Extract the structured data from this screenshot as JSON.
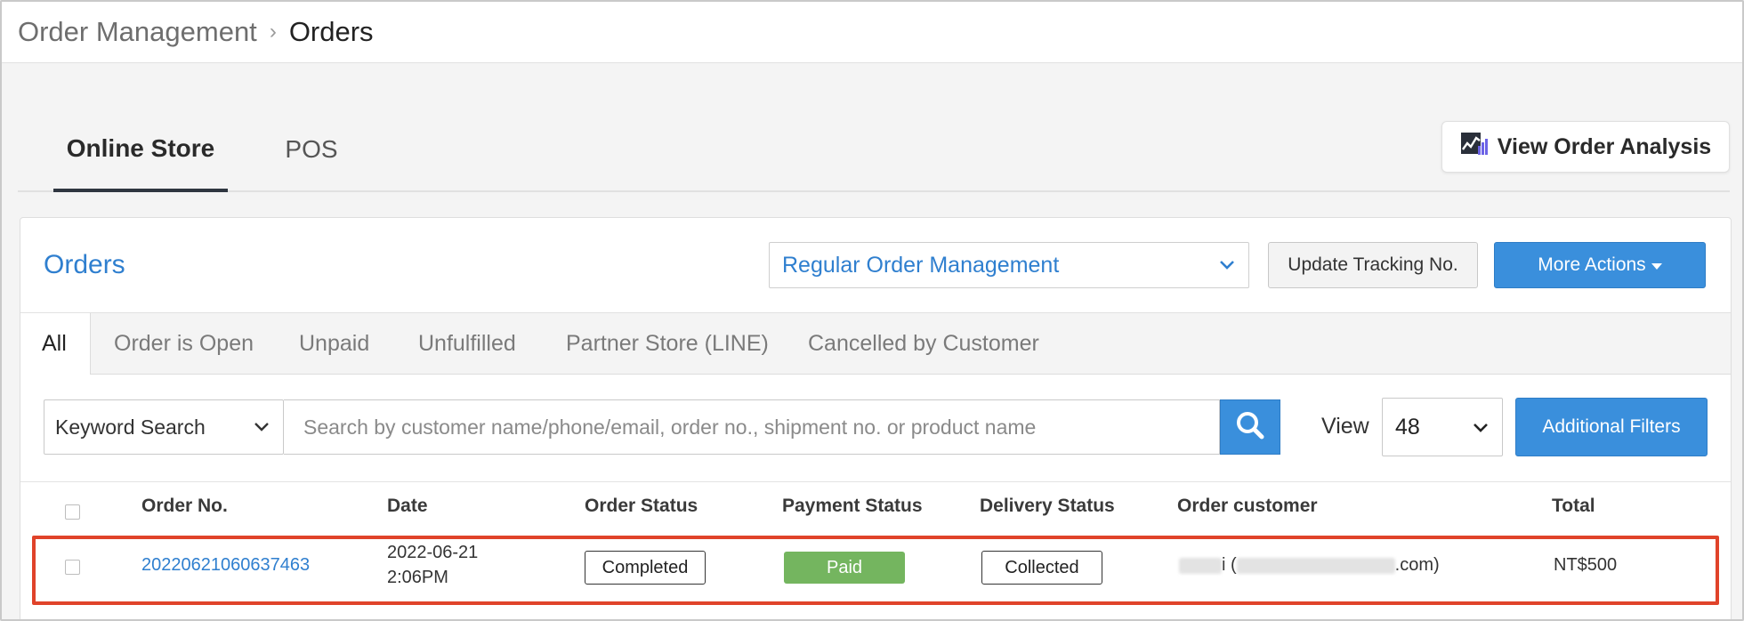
{
  "breadcrumb": {
    "parent": "Order Management",
    "separator": "›",
    "current": "Orders"
  },
  "store_tabs": [
    {
      "label": "Online Store",
      "active": true
    },
    {
      "label": "POS",
      "active": false
    }
  ],
  "analysis_button": {
    "label": "View Order Analysis",
    "icon": "chart-icon"
  },
  "panel": {
    "title": "Orders",
    "management_select": {
      "value": "Regular Order Management"
    },
    "update_tracking_label": "Update Tracking No.",
    "more_actions_label": "More Actions"
  },
  "filter_tabs": [
    {
      "label": "All",
      "active": true
    },
    {
      "label": "Order is Open"
    },
    {
      "label": "Unpaid"
    },
    {
      "label": "Unfulfilled"
    },
    {
      "label": "Partner Store (LINE)"
    },
    {
      "label": "Cancelled by Customer"
    }
  ],
  "search": {
    "type_select": "Keyword Search",
    "placeholder": "Search by customer name/phone/email, order no., shipment no. or product name",
    "value": "",
    "view_label": "View",
    "view_value": "48",
    "additional_filters_label": "Additional Filters"
  },
  "table": {
    "columns": [
      "Order No.",
      "Date",
      "Order Status",
      "Payment Status",
      "Delivery Status",
      "Order customer",
      "Total"
    ],
    "rows": [
      {
        "order_no": "20220621060637463",
        "date": "2022-06-21",
        "time": "2:06PM",
        "order_status": "Completed",
        "payment_status": "Paid",
        "delivery_status": "Collected",
        "customer_visible_suffix": "i (",
        "customer_visible_end": ".com)",
        "total": "NT$500"
      }
    ]
  },
  "colors": {
    "accent_blue": "#3a8fdc",
    "link_blue": "#2f7fcf",
    "paid_green": "#74b55f",
    "highlight_red": "#e0432a"
  }
}
